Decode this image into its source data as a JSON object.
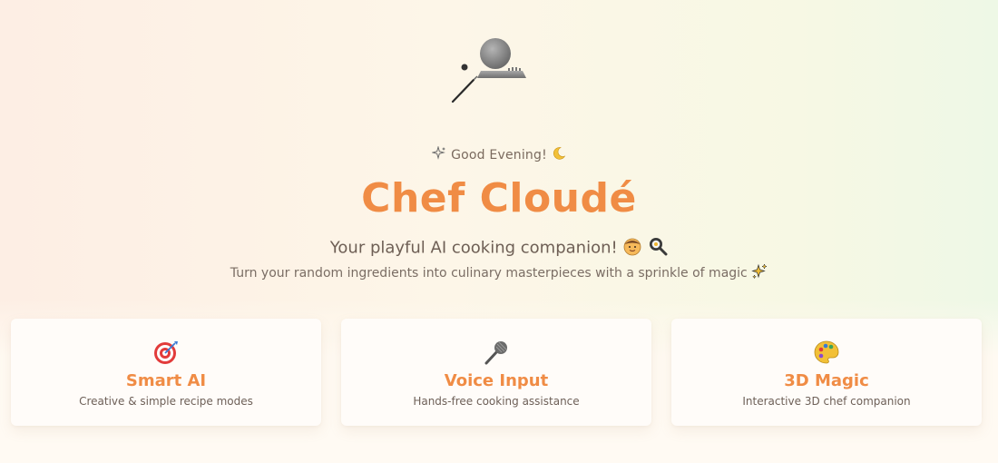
{
  "hero": {
    "greeting": "Good Evening!",
    "title": "Chef Cloudé",
    "subtitle": "Your playful AI cooking companion!",
    "tagline": "Turn your random ingredients into culinary masterpieces with a sprinkle of magic"
  },
  "icons": {
    "chef_figure": "chef-3d-icon",
    "greeting_left": "sparkles-icon",
    "greeting_right": "crescent-moon-icon",
    "subtitle_1": "chef-face-icon",
    "subtitle_2": "frying-pan-icon",
    "tagline": "sparkles-icon"
  },
  "features": [
    {
      "icon": "target-icon",
      "title": "Smart AI",
      "description": "Creative & simple recipe modes"
    },
    {
      "icon": "microphone-icon",
      "title": "Voice Input",
      "description": "Hands-free cooking assistance"
    },
    {
      "icon": "palette-icon",
      "title": "3D Magic",
      "description": "Interactive 3D chef companion"
    }
  ],
  "colors": {
    "accent": "#f08c45",
    "text": "#6e5f55",
    "card_bg": "#fffcf9"
  }
}
